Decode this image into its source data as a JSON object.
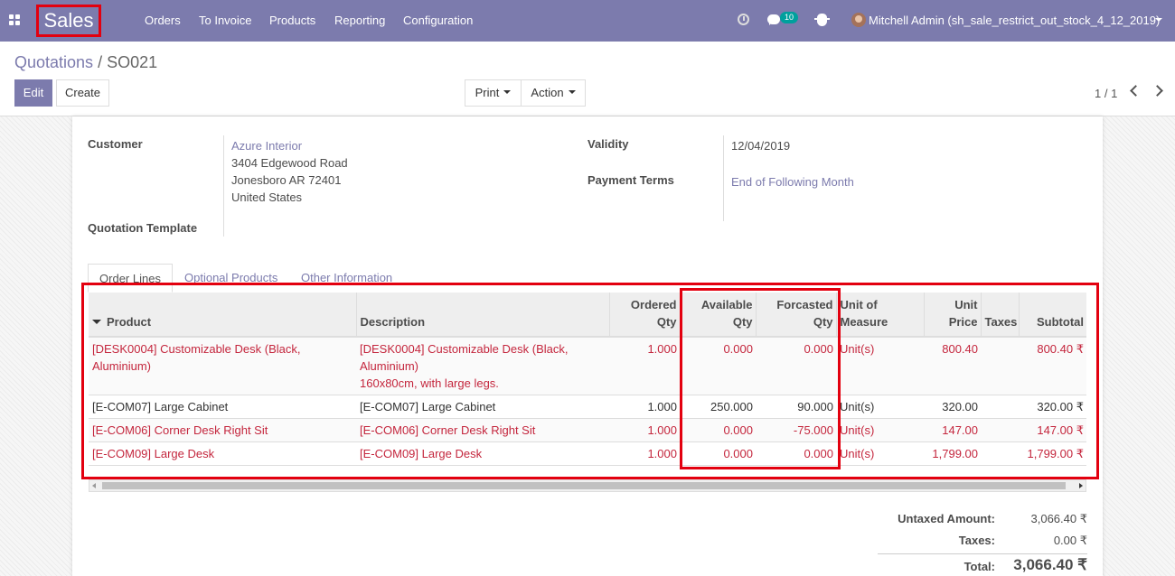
{
  "navbar": {
    "brand": "Sales",
    "menu": [
      "Orders",
      "To Invoice",
      "Products",
      "Reporting",
      "Configuration"
    ],
    "messages_count": "10",
    "user": "Mitchell Admin (sh_sale_restrict_out_stock_4_12_2019)"
  },
  "breadcrumb": {
    "parent": "Quotations",
    "separator": " / ",
    "current": "SO021"
  },
  "buttons": {
    "edit": "Edit",
    "create": "Create",
    "print": "Print",
    "action": "Action"
  },
  "pager": {
    "text": "1 / 1"
  },
  "form": {
    "customer_label": "Customer",
    "customer_name": "Azure Interior",
    "customer_address": [
      "3404 Edgewood Road",
      "Jonesboro AR 72401",
      "United States"
    ],
    "quotation_template_label": "Quotation Template",
    "validity_label": "Validity",
    "validity": "12/04/2019",
    "payment_terms_label": "Payment Terms",
    "payment_terms": "End of Following Month"
  },
  "tabs": [
    "Order Lines",
    "Optional Products",
    "Other Information"
  ],
  "table": {
    "headers": {
      "product": "Product",
      "description": "Description",
      "ordered_qty": [
        "Ordered",
        "Qty"
      ],
      "available_qty": [
        "Available",
        "Qty"
      ],
      "forcasted_qty": [
        "Forcasted",
        "Qty"
      ],
      "uom": [
        "Unit of",
        "Measure"
      ],
      "unit_price": [
        "Unit",
        "Price"
      ],
      "taxes": "Taxes",
      "subtotal": "Subtotal"
    },
    "rows": [
      {
        "product": "[DESK0004] Customizable Desk (Black, Aluminium)",
        "description": [
          "[DESK0004] Customizable Desk (Black,",
          "Aluminium)",
          "160x80cm, with large legs."
        ],
        "ordered_qty": "1.000",
        "available_qty": "0.000",
        "forcasted_qty": "0.000",
        "uom": "Unit(s)",
        "unit_price": "800.40",
        "taxes": "",
        "subtotal": "800.40 ₹"
      },
      {
        "product": "[E-COM07] Large Cabinet",
        "description": [
          "[E-COM07] Large Cabinet"
        ],
        "ordered_qty": "1.000",
        "available_qty": "250.000",
        "forcasted_qty": "90.000",
        "uom": "Unit(s)",
        "unit_price": "320.00",
        "taxes": "",
        "subtotal": "320.00 ₹"
      },
      {
        "product": "[E-COM06] Corner Desk Right Sit",
        "description": [
          "[E-COM06] Corner Desk Right Sit"
        ],
        "ordered_qty": "1.000",
        "available_qty": "0.000",
        "forcasted_qty": "-75.000",
        "uom": "Unit(s)",
        "unit_price": "147.00",
        "taxes": "",
        "subtotal": "147.00 ₹"
      },
      {
        "product": "[E-COM09] Large Desk",
        "description": [
          "[E-COM09] Large Desk"
        ],
        "ordered_qty": "1.000",
        "available_qty": "0.000",
        "forcasted_qty": "0.000",
        "uom": "Unit(s)",
        "unit_price": "1,799.00",
        "taxes": "",
        "subtotal": "1,799.00 ₹"
      }
    ]
  },
  "totals": {
    "untaxed_label": "Untaxed Amount:",
    "untaxed": "3,066.40 ₹",
    "taxes_label": "Taxes:",
    "taxes": "0.00 ₹",
    "total_label": "Total:",
    "total": "3,066.40 ₹"
  },
  "colors": {
    "navbar": "#7c7bad",
    "highlight": "#e3000f",
    "out_of_stock_row": "#c4263d",
    "link": "#7c7bad"
  }
}
